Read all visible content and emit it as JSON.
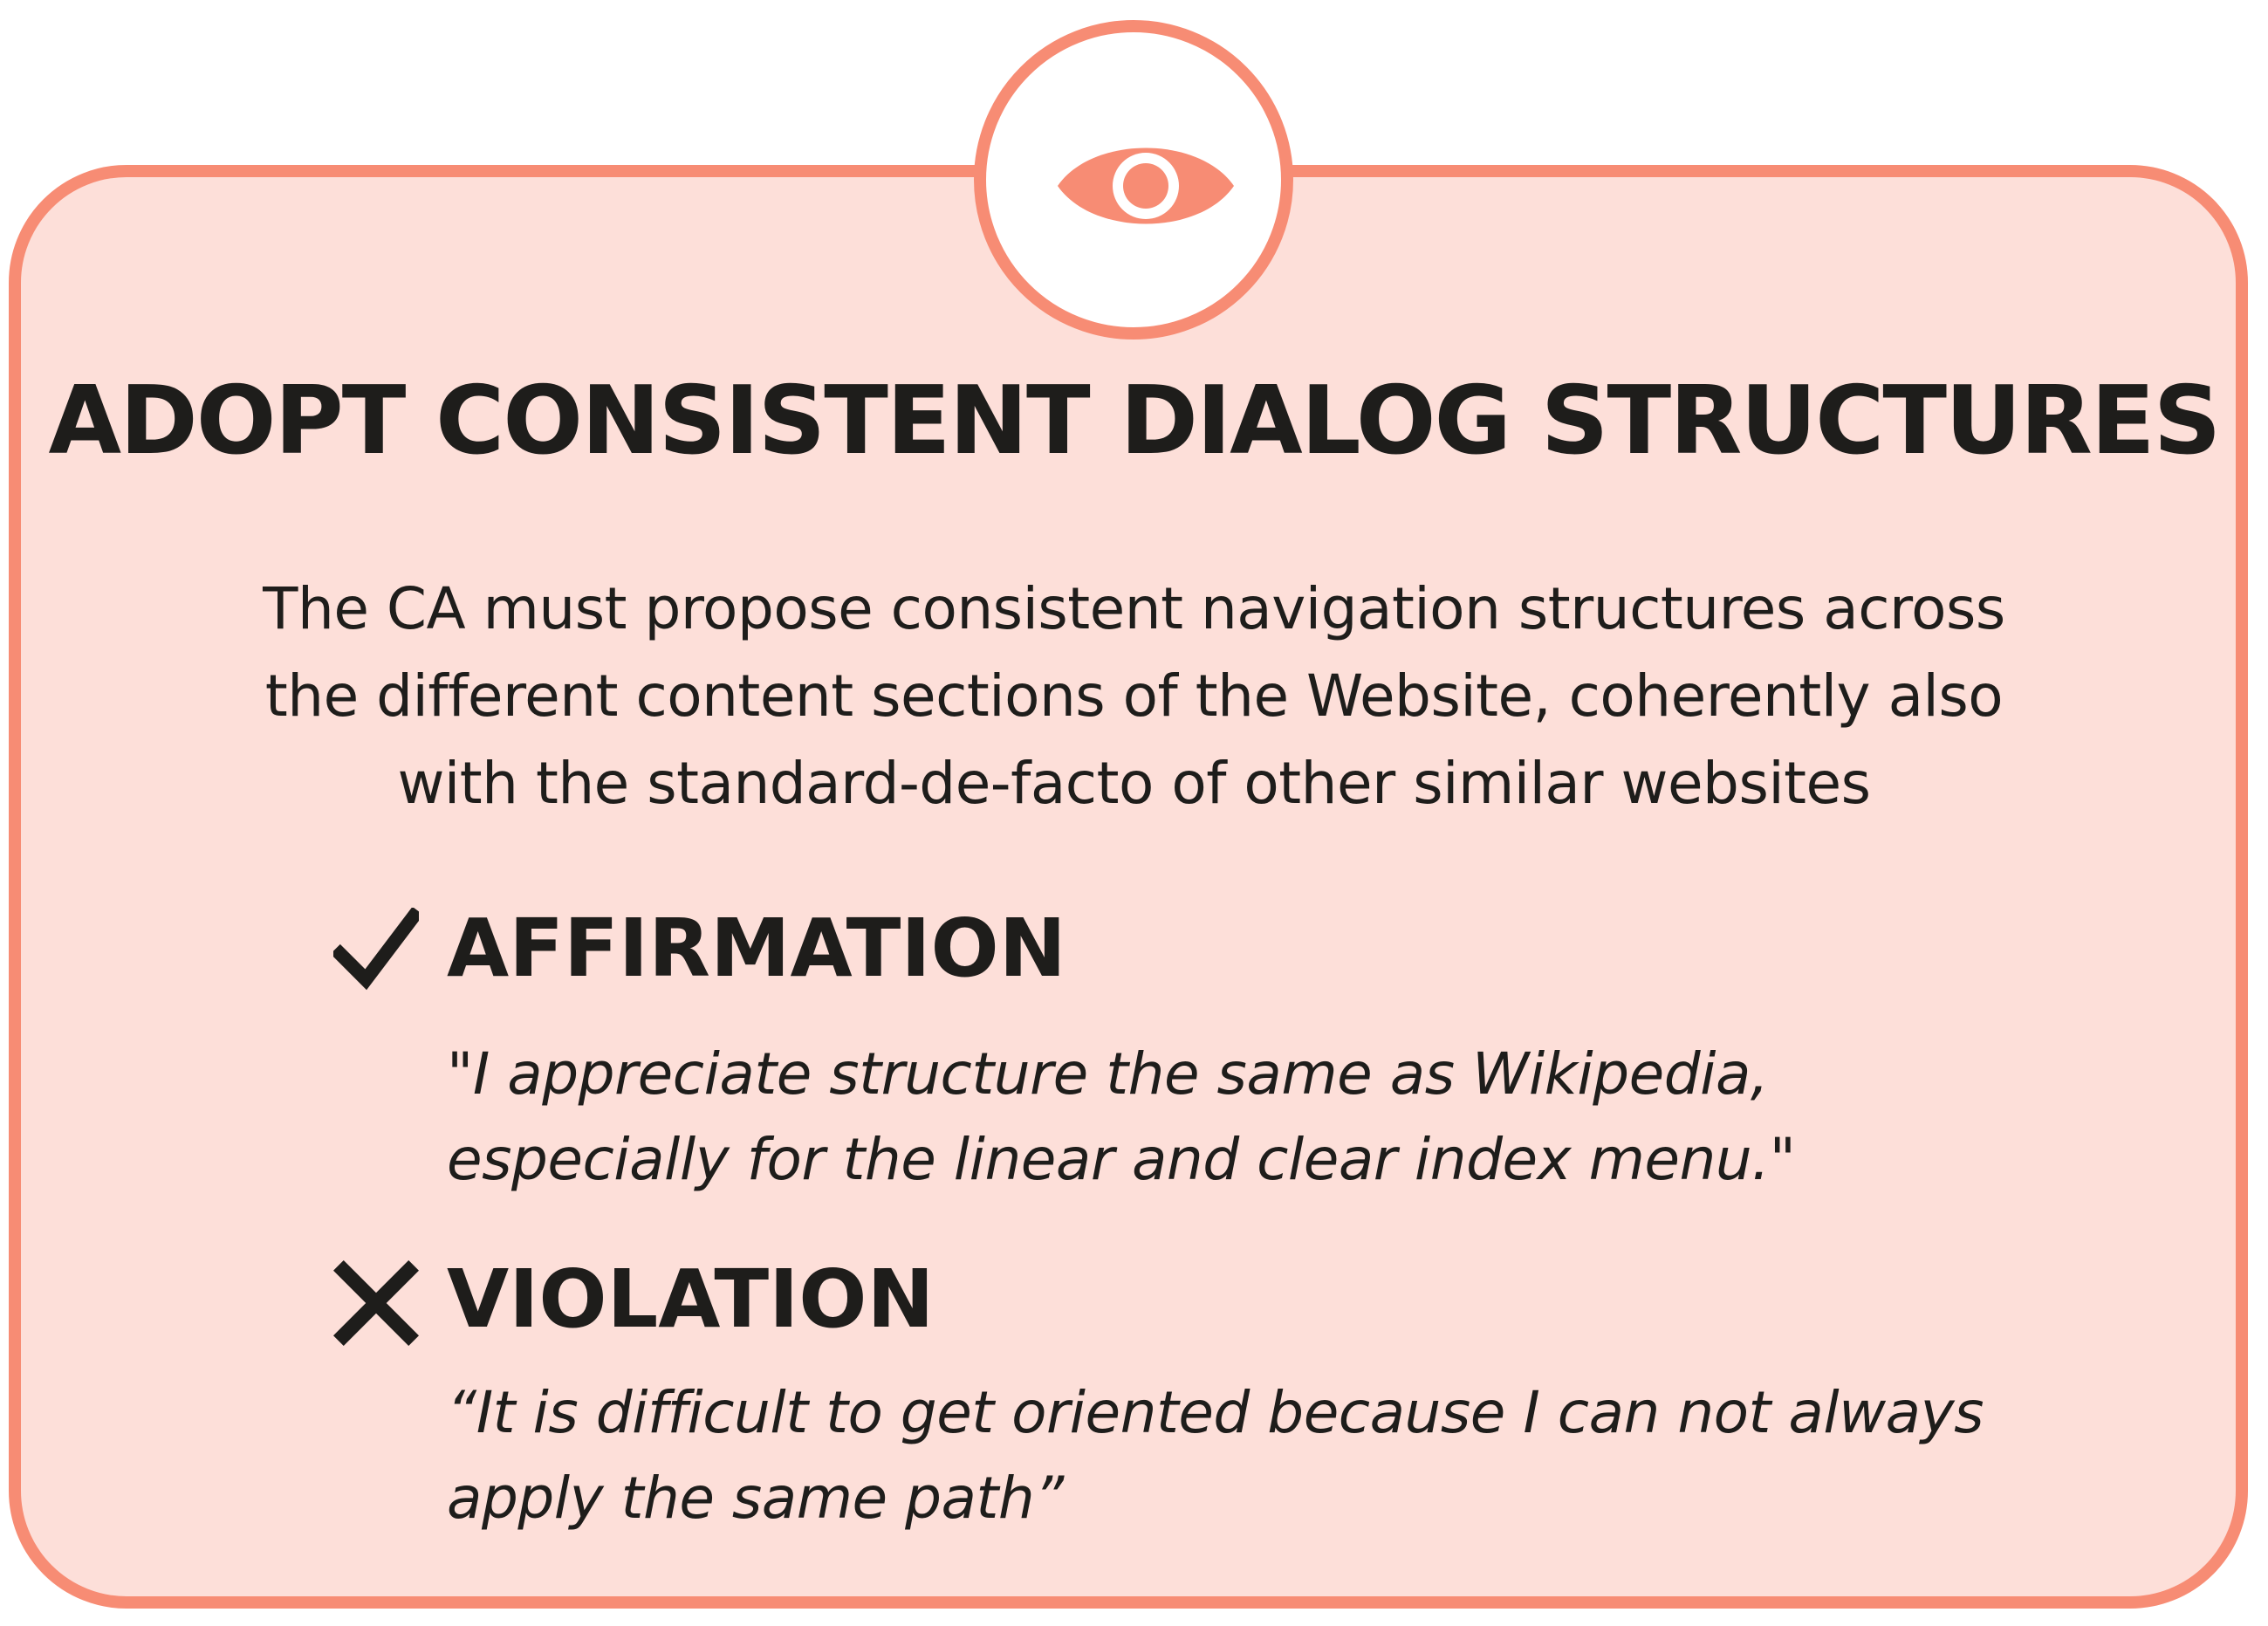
{
  "colors": {
    "accent": "#f78c74",
    "card_background": "#fddfd9",
    "text": "#1e1d1b"
  },
  "badge": {
    "icon": "eye-icon"
  },
  "title": "ADOPT CONSISTENT DIALOG STRUCTURES",
  "description": [
    "The CA must propose consistent navigation structures across",
    "the different content sections of the Website, coherently also",
    "with the standard-de-facto of other similar websites"
  ],
  "affirmation": {
    "icon": "checkmark-icon",
    "heading": "AFFIRMATION",
    "quote": [
      "\"I appreciate structure the same as Wikipedia,",
      "especially for the linear and clear index menu.\""
    ]
  },
  "violation": {
    "icon": "cross-icon",
    "heading": "VIOLATION",
    "quote": [
      "“It is difficult to get oriented because I can not always",
      "apply the same path”"
    ]
  }
}
